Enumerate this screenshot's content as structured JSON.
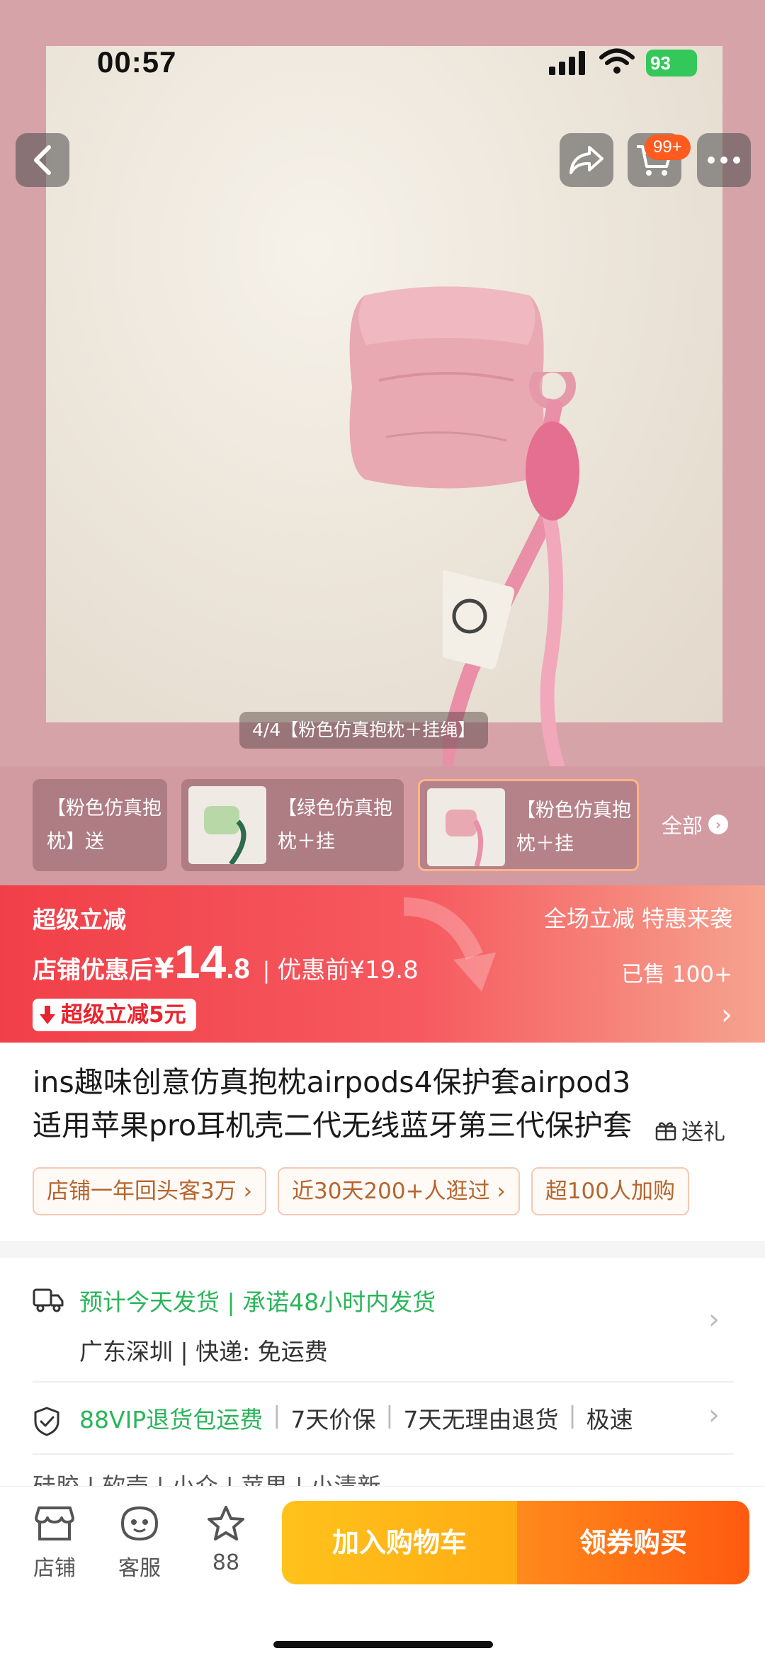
{
  "status_bar": {
    "time": "00:57",
    "battery": "93"
  },
  "nav": {
    "cart_badge": "99+"
  },
  "gallery": {
    "caption": "4/4【粉色仿真抱枕＋挂绳】"
  },
  "thumbs": [
    {
      "text": "【粉色仿真抱枕】送"
    },
    {
      "text": "【绿色仿真抱枕＋挂"
    },
    {
      "text": "【粉色仿真抱枕＋挂"
    }
  ],
  "view_all": "全部",
  "promo": {
    "title": "超级立减",
    "right_text": "全场立减 特惠来袭",
    "price_label": "店铺优惠后",
    "currency": "¥",
    "price_int": "14",
    "price_dec": ".8",
    "separator": "|",
    "original_price": "优惠前¥19.8",
    "sold": "已售 100+",
    "chip": "超级立减5元",
    "chevron": "›"
  },
  "product": {
    "title_line1": "ins趣味创意仿真抱枕airpods4保护套airpod3",
    "title_line2": "适用苹果pro耳机壳二代无线蓝牙第三代保护套",
    "gift": "送礼",
    "tags": [
      "店铺一年回头客3万 ›",
      "近30天200+人逛过 ›",
      "超100人加购"
    ]
  },
  "delivery": {
    "line1": "预计今天发货 | 承诺48小时内发货",
    "line2": "广东深圳 | 快递: 免运费"
  },
  "service": {
    "green": "88VIP退货包运费",
    "items": [
      "7天价保",
      "7天无理由退货",
      "极速"
    ]
  },
  "specs": "硅胶 | 软壳 | 小众 | 苹果 | 小清新",
  "bottom_bar": {
    "store": "店铺",
    "customer_service": "客服",
    "favorites": "88",
    "add_to_cart": "加入购物车",
    "buy": "领券购买"
  },
  "colors": {
    "promo_red": "#f13f48",
    "green": "#2ab55a",
    "cart_yellow": "#ffb713",
    "buy_orange": "#ff6a14"
  }
}
